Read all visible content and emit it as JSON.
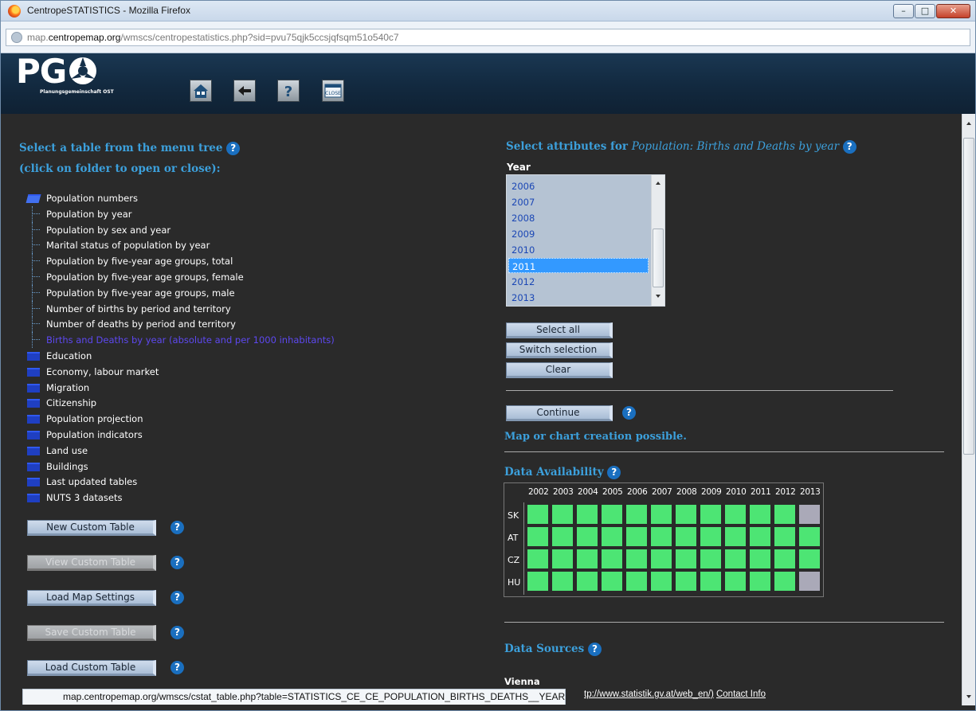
{
  "window": {
    "title": "CentropeSTATISTICS - Mozilla Firefox"
  },
  "address": {
    "prefix": "map.",
    "domain": "centropemap.org",
    "path": "/wmscs/centropestatistics.php?sid=pvu75qjk5ccsjqfsqm51o540c7"
  },
  "header": {
    "logo_text": "PG",
    "logo_sub": "Planungsgemeinschaft OST",
    "close_label": "CLOSE"
  },
  "left": {
    "title_line1": "Select a table from the menu tree",
    "title_line2": "(click on folder to open or close):",
    "tree": [
      {
        "label": "Population numbers",
        "kind": "folder-open"
      },
      {
        "label": "Population by year",
        "kind": "leaf"
      },
      {
        "label": "Population by sex and year",
        "kind": "leaf"
      },
      {
        "label": "Marital status of population by year",
        "kind": "leaf"
      },
      {
        "label": "Population by five-year age groups, total",
        "kind": "leaf"
      },
      {
        "label": "Population by five-year age groups, female",
        "kind": "leaf"
      },
      {
        "label": "Population by five-year age groups, male",
        "kind": "leaf"
      },
      {
        "label": "Number of births by period and territory",
        "kind": "leaf"
      },
      {
        "label": "Number of deaths by period and territory",
        "kind": "leaf"
      },
      {
        "label": "Births and Deaths by year (absolute and per 1000 inhabitants)",
        "kind": "leaf-selected"
      },
      {
        "label": "Education",
        "kind": "folder"
      },
      {
        "label": "Economy, labour market",
        "kind": "folder"
      },
      {
        "label": "Migration",
        "kind": "folder"
      },
      {
        "label": "Citizenship",
        "kind": "folder"
      },
      {
        "label": "Population projection",
        "kind": "folder"
      },
      {
        "label": "Population indicators",
        "kind": "folder"
      },
      {
        "label": "Land use",
        "kind": "folder"
      },
      {
        "label": "Buildings",
        "kind": "folder"
      },
      {
        "label": "Last updated tables",
        "kind": "folder"
      },
      {
        "label": "NUTS 3 datasets",
        "kind": "folder"
      }
    ],
    "buttons": {
      "new_custom": "New Custom Table",
      "view_custom": "View Custom Table",
      "load_map": "Load Map Settings",
      "save_custom": "Save Custom Table",
      "load_custom": "Load Custom Table"
    }
  },
  "right": {
    "title_prefix": "Select attributes for",
    "title_table": "Population: Births and Deaths by year",
    "year_label": "Year",
    "years": [
      "2006",
      "2007",
      "2008",
      "2009",
      "2010",
      "2011",
      "2012",
      "2013"
    ],
    "selected_year": "2011",
    "buttons": {
      "select_all": "Select all",
      "switch": "Switch selection",
      "clear": "Clear",
      "continue": "Continue"
    },
    "map_chart_msg": "Map or chart creation possible.",
    "data_availability_title": "Data Availability",
    "avail_years": [
      "2002",
      "2003",
      "2004",
      "2005",
      "2006",
      "2007",
      "2008",
      "2009",
      "2010",
      "2011",
      "2012",
      "2013"
    ],
    "avail_rows": [
      {
        "country": "SK",
        "available": [
          1,
          1,
          1,
          1,
          1,
          1,
          1,
          1,
          1,
          1,
          1,
          0
        ]
      },
      {
        "country": "AT",
        "available": [
          1,
          1,
          1,
          1,
          1,
          1,
          1,
          1,
          1,
          1,
          1,
          1
        ]
      },
      {
        "country": "CZ",
        "available": [
          1,
          1,
          1,
          1,
          1,
          1,
          1,
          1,
          1,
          1,
          1,
          1
        ]
      },
      {
        "country": "HU",
        "available": [
          1,
          1,
          1,
          1,
          1,
          1,
          1,
          1,
          1,
          1,
          1,
          0
        ]
      }
    ],
    "data_sources_title": "Data Sources",
    "first_source": "Vienna"
  },
  "status": {
    "url": "map.centropemap.org/wmscs/cstat_table.php?table=STATISTICS_CE_CE_POPULATION_BIRTHS_DEATHS__YEAR",
    "tail_link": "tp://www.statistik.gv.at/web_en/)",
    "tail_contact": "Contact Info"
  },
  "colors": {
    "accent": "#3ca0dc",
    "available": "#4de574",
    "unavailable": "#aaa9b8",
    "selected_tree": "#5d48f0"
  }
}
